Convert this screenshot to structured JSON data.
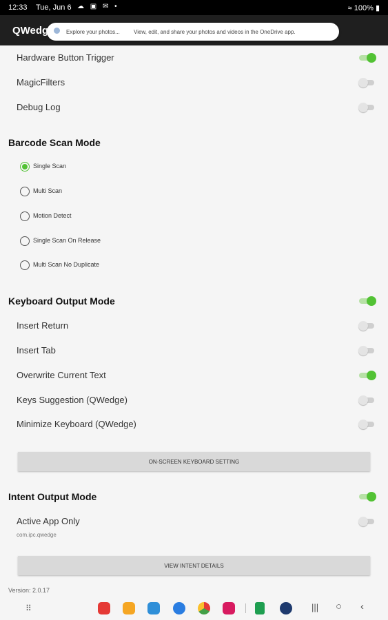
{
  "status_bar": {
    "time": "12:33",
    "date": "Tue, Jun 6",
    "battery": "100%",
    "signal_icons": "☁ ▣ ✉ •"
  },
  "app": {
    "title": "QWedge"
  },
  "notification": {
    "title": "Explore your photos...",
    "text": "View, edit, and share your photos and videos in the OneDrive app."
  },
  "settings": {
    "hardware_button_trigger": {
      "label": "Hardware Button Trigger",
      "on": true
    },
    "magic_filters": {
      "label": "MagicFilters",
      "on": false
    },
    "debug_log": {
      "label": "Debug Log",
      "on": false
    }
  },
  "barcode_scan_mode": {
    "title": "Barcode Scan Mode",
    "options": [
      "Single Scan",
      "Multi Scan",
      "Motion Detect",
      "Single Scan On Release",
      "Multi Scan No Duplicate"
    ],
    "selected": "Single Scan"
  },
  "keyboard_output": {
    "title": "Keyboard Output Mode",
    "on": true,
    "items": [
      {
        "label": "Insert Return",
        "on": false
      },
      {
        "label": "Insert Tab",
        "on": false
      },
      {
        "label": "Overwrite Current Text",
        "on": true
      },
      {
        "label": "Keys Suggestion (QWedge)",
        "on": false
      },
      {
        "label": "Minimize Keyboard (QWedge)",
        "on": false
      }
    ],
    "button": "ON-SCREEN KEYBOARD SETTING"
  },
  "intent_output": {
    "title": "Intent Output Mode",
    "on": true,
    "active_app_only": {
      "label": "Active App Only",
      "on": false,
      "subtitle": "com.ipc.qwedge"
    },
    "button": "VIEW INTENT DETAILS"
  },
  "version": "Version: 2.0.17",
  "colors": {
    "accent": "#52c234",
    "app_bar": "#1f1f1f",
    "button": "#d9d9d9"
  },
  "taskbar_apps": [
    "flipboard-icon",
    "files-icon",
    "gallery-icon",
    "messages-icon",
    "chrome-icon",
    "youtube-icon",
    "sheets-icon",
    "settings-icon"
  ]
}
